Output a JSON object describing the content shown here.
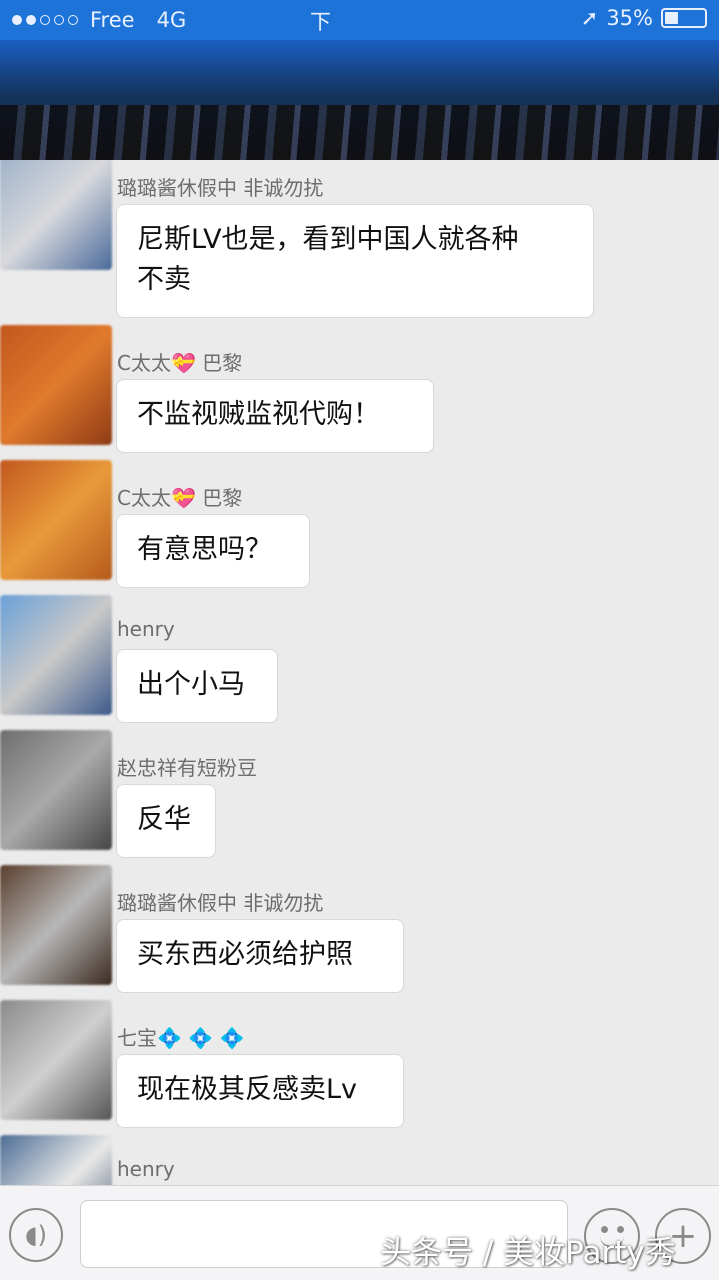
{
  "status_bar": {
    "carrier": "Free",
    "network": "4G",
    "time": "下",
    "battery_text": "35%",
    "battery_level": 0.35
  },
  "messages": [
    {
      "sender": "璐璐酱休假中 非诚勿扰",
      "text_lines": [
        "尼斯LV也是，看到中国人就各种",
        "不卖"
      ]
    },
    {
      "sender": "C太太💝 巴黎",
      "text_lines": [
        "不监视贼监视代购！"
      ]
    },
    {
      "sender": "C太太💝 巴黎",
      "text_lines": [
        "有意思吗？"
      ]
    },
    {
      "sender": "henry",
      "text_lines": [
        "出个小马"
      ]
    },
    {
      "sender": "赵忠祥有短粉豆",
      "text_lines": [
        "反华"
      ]
    },
    {
      "sender": "璐璐酱休假中 非诚勿扰",
      "text_lines": [
        "买东西必须给护照"
      ]
    },
    {
      "sender": "七宝💠 💠 💠",
      "text_lines": [
        "现在极其反感卖Lv"
      ]
    },
    {
      "sender": "henry",
      "text_lines": [
        ""
      ]
    }
  ],
  "input_bar": {
    "voice_icon": "voice-icon",
    "emoji_icon": "emoji-icon",
    "plus_icon": "plus-icon"
  },
  "watermark": "头条号 / 美妆Party秀",
  "colors": {
    "status_bar_bg": "#1d73d8",
    "chat_bg": "#ebebeb",
    "bubble_bg": "#ffffff",
    "sender_text": "#6d6d6d"
  }
}
